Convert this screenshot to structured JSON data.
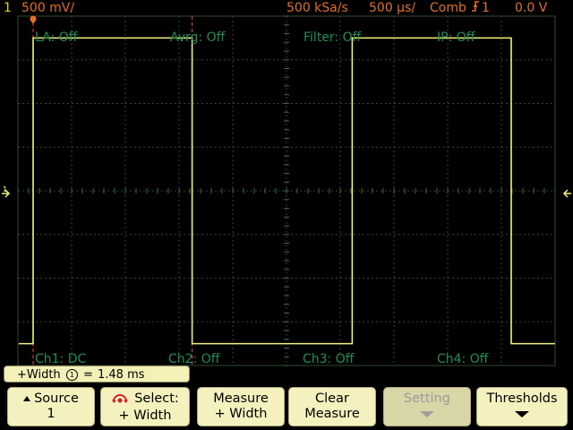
{
  "topbar": {
    "channel_num": "1",
    "volts_div": "500 mV/",
    "sample_rate": "500 kSa/s",
    "time_div": "500 µs/",
    "trigger_mode": "Comb",
    "trigger_icon": "rising-edge-icon",
    "trigger_source": "1",
    "trigger_level": "0.0 V"
  },
  "status_labels": {
    "la": "LA: Off",
    "avrg": "Avrg: Off",
    "filter": "Filter: Off",
    "ip": "IP: Off",
    "ch1": "Ch1: DC",
    "ch2": "Ch2: Off",
    "ch3": "Ch3: Off",
    "ch4": "Ch4: Off"
  },
  "measurement": {
    "label": "+Width",
    "channel": "1",
    "equals": "=",
    "value": "1.48 ms"
  },
  "softkeys": [
    {
      "line1": "Source",
      "line2": "1"
    },
    {
      "line1": "Select:",
      "line2": "+ Width"
    },
    {
      "line1": "Measure",
      "line2": "+ Width"
    },
    {
      "line1": "Clear",
      "line2": "Measure"
    },
    {
      "line1": "Setting",
      "line2": ""
    },
    {
      "line1": "Thresholds",
      "line2": ""
    }
  ],
  "colors": {
    "trace": "#f2f27a",
    "grid": "#2f4a2f",
    "label_green": "#1f8f57",
    "topbar_orange": "#e0702a",
    "cursor_red": "#ff4040"
  },
  "waveform": {
    "type": "square",
    "high_level_div": 3.5,
    "low_level_div": -3.5,
    "edges_ms": [
      0.0,
      1.48,
      2.97,
      4.45
    ]
  }
}
